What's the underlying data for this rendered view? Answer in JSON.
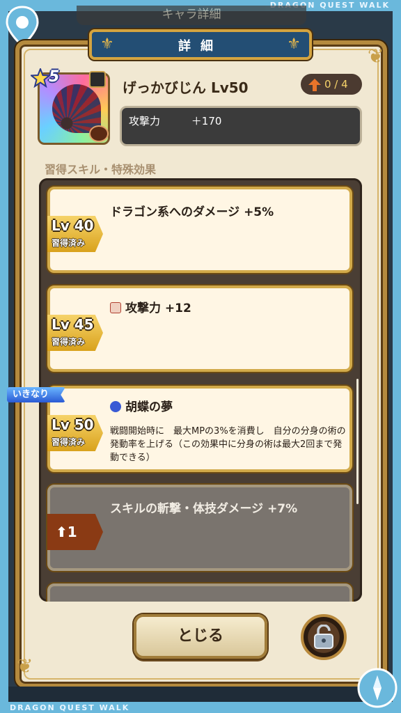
{
  "brand": {
    "top": "DRAGON QUEST WALK",
    "bottom": "DRAGON QUEST WALK"
  },
  "background_title": "キャラ詳細",
  "dialog": {
    "title": "詳細"
  },
  "item": {
    "rarity": "5",
    "name": "げっかびじん Lv50",
    "upgrade": "0 / 4",
    "stat_label": "攻撃力",
    "stat_value": "＋170"
  },
  "section_label": "習得スキル・特殊効果",
  "skills": [
    {
      "lv": "Lv 40",
      "status": "習得済み",
      "text": "ドラゴン系へのダメージ +5%"
    },
    {
      "lv": "Lv 45",
      "status": "習得済み",
      "text": "攻撃力 +12",
      "icon": "weapon-stat-icon"
    },
    {
      "lv": "Lv 50",
      "status": "習得済み",
      "badge": "いきなり",
      "text": "胡蝶の夢",
      "icon": "skill-triangle-icon",
      "desc": "戦闘開始時に　最大MPの3%を消費し　自分の分身の術の発動率を上げる（この効果中に分身の術は最大2回まで発動できる）"
    },
    {
      "lock": "1",
      "text": "スキルの斬撃・体技ダメージ +7%"
    }
  ],
  "buttons": {
    "close": "とじる",
    "lock_icon": "lock-icon"
  },
  "colors": {
    "frame": "#6ab8dc",
    "panel": "#f1e8d2",
    "gold": "#d2aa4a",
    "header": "#234e74"
  }
}
